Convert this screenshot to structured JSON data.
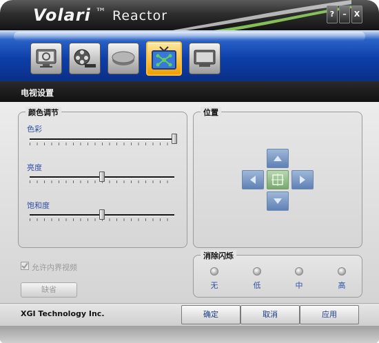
{
  "window": {
    "brand": "Volari",
    "trademark": "™",
    "product": "Reactor",
    "help_label": "?",
    "minimize_label": "–",
    "close_label": "X"
  },
  "toolbar": {
    "items": [
      {
        "name": "display-settings-icon"
      },
      {
        "name": "video-reel-icon"
      },
      {
        "name": "disc-icon"
      },
      {
        "name": "tv-settings-icon",
        "active": true
      },
      {
        "name": "monitor-icon"
      }
    ]
  },
  "section": {
    "title": "电视设置"
  },
  "color_group": {
    "title": "颜色调节",
    "sliders": [
      {
        "label": "色彩",
        "value": 1.0
      },
      {
        "label": "亮度",
        "value": 0.5
      },
      {
        "label": "饱和度",
        "value": 0.5
      }
    ]
  },
  "position_group": {
    "title": "位置"
  },
  "flicker_group": {
    "title": "消除闪烁",
    "options": [
      "无",
      "低",
      "中",
      "高"
    ]
  },
  "overscan": {
    "label": "允许内界视频",
    "checked": true,
    "enabled": false
  },
  "default_button": {
    "label": "缺省"
  },
  "footer": {
    "company": "XGI Technology Inc.",
    "ok": "确定",
    "cancel": "取消",
    "apply": "应用"
  },
  "colors": {
    "toolbar_blue": "#0d3fa8",
    "label_blue": "#2e4fa6",
    "active_orange": "#f0a000"
  }
}
